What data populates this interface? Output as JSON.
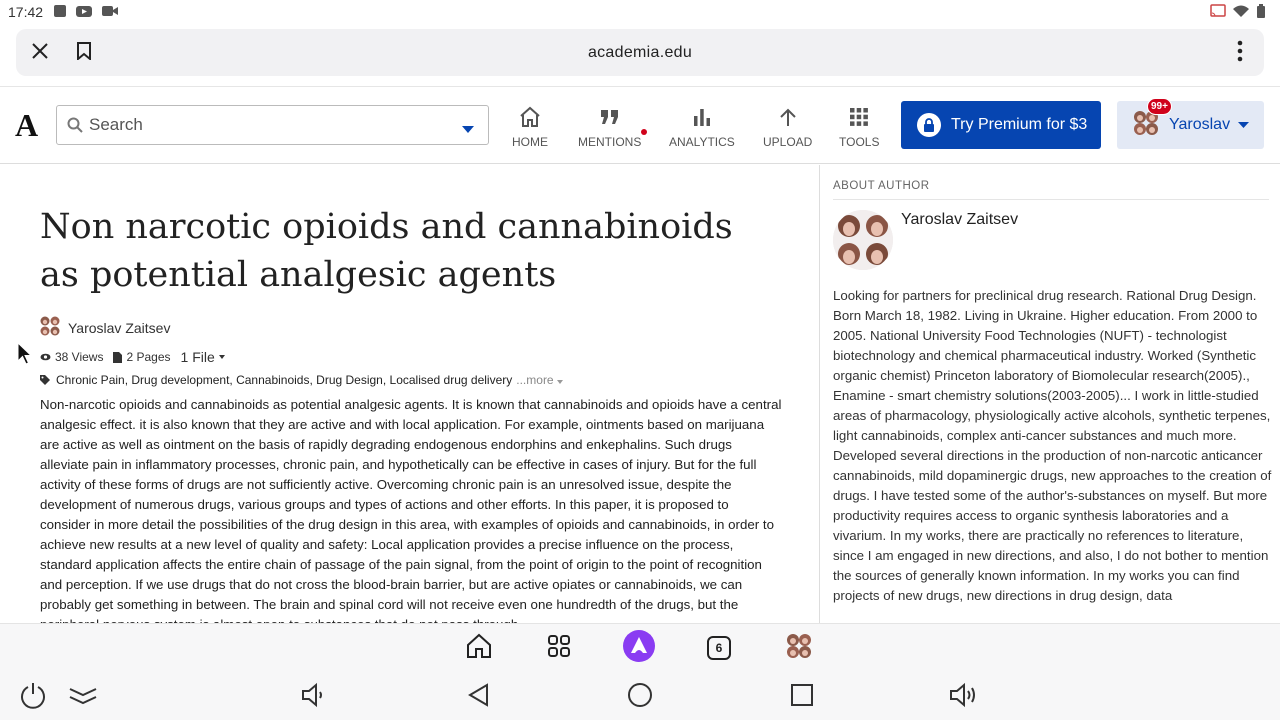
{
  "status_bar": {
    "time": "17:42"
  },
  "browser": {
    "url": "academia.edu"
  },
  "header": {
    "logo": "A",
    "search_placeholder": "Search",
    "nav": [
      {
        "label": "HOME",
        "icon": "home-icon"
      },
      {
        "label": "MENTIONS",
        "icon": "quote-icon",
        "has_dot": true
      },
      {
        "label": "ANALYTICS",
        "icon": "bar-chart-icon"
      },
      {
        "label": "UPLOAD",
        "icon": "upload-arrow-icon"
      },
      {
        "label": "TOOLS",
        "icon": "grid-icon"
      }
    ],
    "premium_label": "Try Premium for $3",
    "user_name": "Yaroslav",
    "notification_badge": "99+"
  },
  "paper": {
    "title": "Non narcotic opioids and cannabinoids as potential analgesic agents",
    "author": "Yaroslav Zaitsev",
    "views": "38 Views",
    "pages": "2 Pages",
    "files": "1 File",
    "tags": "Chronic Pain, Drug development, Cannabinoids, Drug Design, Localised drug delivery",
    "tags_more": "...more",
    "abstract": "Non-narcotic opioids and cannabinoids as potential analgesic agents. It is known that cannabinoids and opioids have a central analgesic effect. it is also known that they are active and with local application. For example, ointments based on marijuana are active as well as ointment on the basis of rapidly degrading endogenous endorphins and enkephalins. Such drugs alleviate pain in inflammatory processes, chronic pain, and hypothetically can be effective in cases of injury. But for the full activity of these forms of drugs are not sufficiently active. Overcoming chronic pain is an unresolved issue, despite the development of numerous drugs, various groups and types of actions and other efforts. In this paper, it is proposed to consider in more detail the possibilities of the drug design in this area, with examples of opioids and cannabinoids, in order to achieve new results at a new level of quality and safety: Local application provides a precise influence on the process, standard application affects the entire chain of passage of the pain signal, from the point of origin to the point of recognition and perception. If we use drugs that do not cross the blood-brain barrier, but are active opiates or cannabinoids, we can probably get something in between. The brain and spinal cord will not receive even one hundredth of the drugs, but the peripheral nervous system is almost open to substances that do not pass through"
  },
  "sidebar": {
    "label": "ABOUT AUTHOR",
    "author_name": "Yaroslav Zaitsev",
    "bio": "Looking for partners for preclinical drug research. Rational Drug Design. Born March 18, 1982. Living in Ukraine. Higher education. From 2000 to 2005. National University Food Technologies (NUFT) - technologist biotechnology and chemical pharmaceutical industry. Worked (Synthetic organic chemist) Princeton laboratory of Biomolecular research(2005)., Enamine - smart chemistry solutions(2003-2005)... I work in little-studied areas of pharmacology, physiologically active alcohols, synthetic terpenes, light cannabinoids, complex anti-cancer substances and much more. Developed several directions in the production of non-narcotic anticancer cannabinoids, mild dopaminergic drugs, new approaches to the creation of drugs. I have tested some of the author's-substances on myself. But more productivity requires access to organic synthesis laboratories and a vivarium. In my works, there are practically no references to literature, since I am engaged in new directions, and also, I do not bother to mention the sources of generally known information. In my works you can find projects of new drugs, new directions in drug design, data"
  },
  "dock": {
    "tabs_count": "6"
  },
  "colors": {
    "primary_blue": "#0645b1",
    "alert_red": "#d0021b",
    "assistant_purple": "#8a3cf2"
  }
}
